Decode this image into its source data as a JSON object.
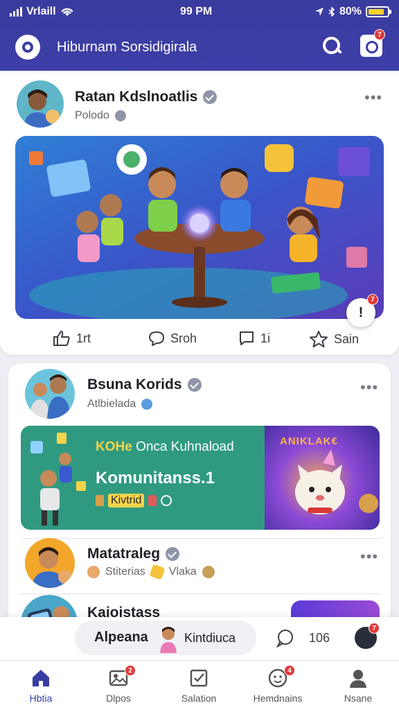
{
  "status_bar": {
    "carrier": "Vrlaill",
    "time": "99 PM",
    "battery": "80%"
  },
  "header": {
    "title": "Hiburnam Sorsidigirala"
  },
  "header_badges": {
    "notifications": "7"
  },
  "post1": {
    "author": "Ratan Kdslnoatlis",
    "subtitle": "Polodo",
    "actions": {
      "like": "1rt",
      "comment": "Sroh",
      "reply": "1i",
      "save": "Sain"
    },
    "fab_label": "!",
    "fab_badge": "7"
  },
  "post2": {
    "author": "Bsuna Korids",
    "subtitle": "Atlbielada",
    "promo": {
      "line1_highlight": "KOHe",
      "line1": "Onca Kuhnaload",
      "line2": "Komunitanss.1",
      "tag": "Kivtrid",
      "sign": "ANIKLAK€"
    }
  },
  "post3": {
    "author": "Matatraleg",
    "subtitle": "Stiterias",
    "subtitle2": "Vlaka"
  },
  "post4": {
    "author": "Kaioistass"
  },
  "bottom_strip": {
    "left": "Alpeana",
    "right": "Kintdiuca",
    "count": "106",
    "badge": "7"
  },
  "tabs": [
    {
      "label": "Hbtia",
      "active": true
    },
    {
      "label": "Dlpos",
      "badge": "2"
    },
    {
      "label": "Salation"
    },
    {
      "label": "Hemdnains",
      "badge": "4"
    },
    {
      "label": "Nsane"
    }
  ],
  "colors": {
    "header_bg": "#3d3fa8",
    "accent": "#3a3da2",
    "badge": "#e23a3a",
    "promo_bg": "#2f9a80"
  }
}
